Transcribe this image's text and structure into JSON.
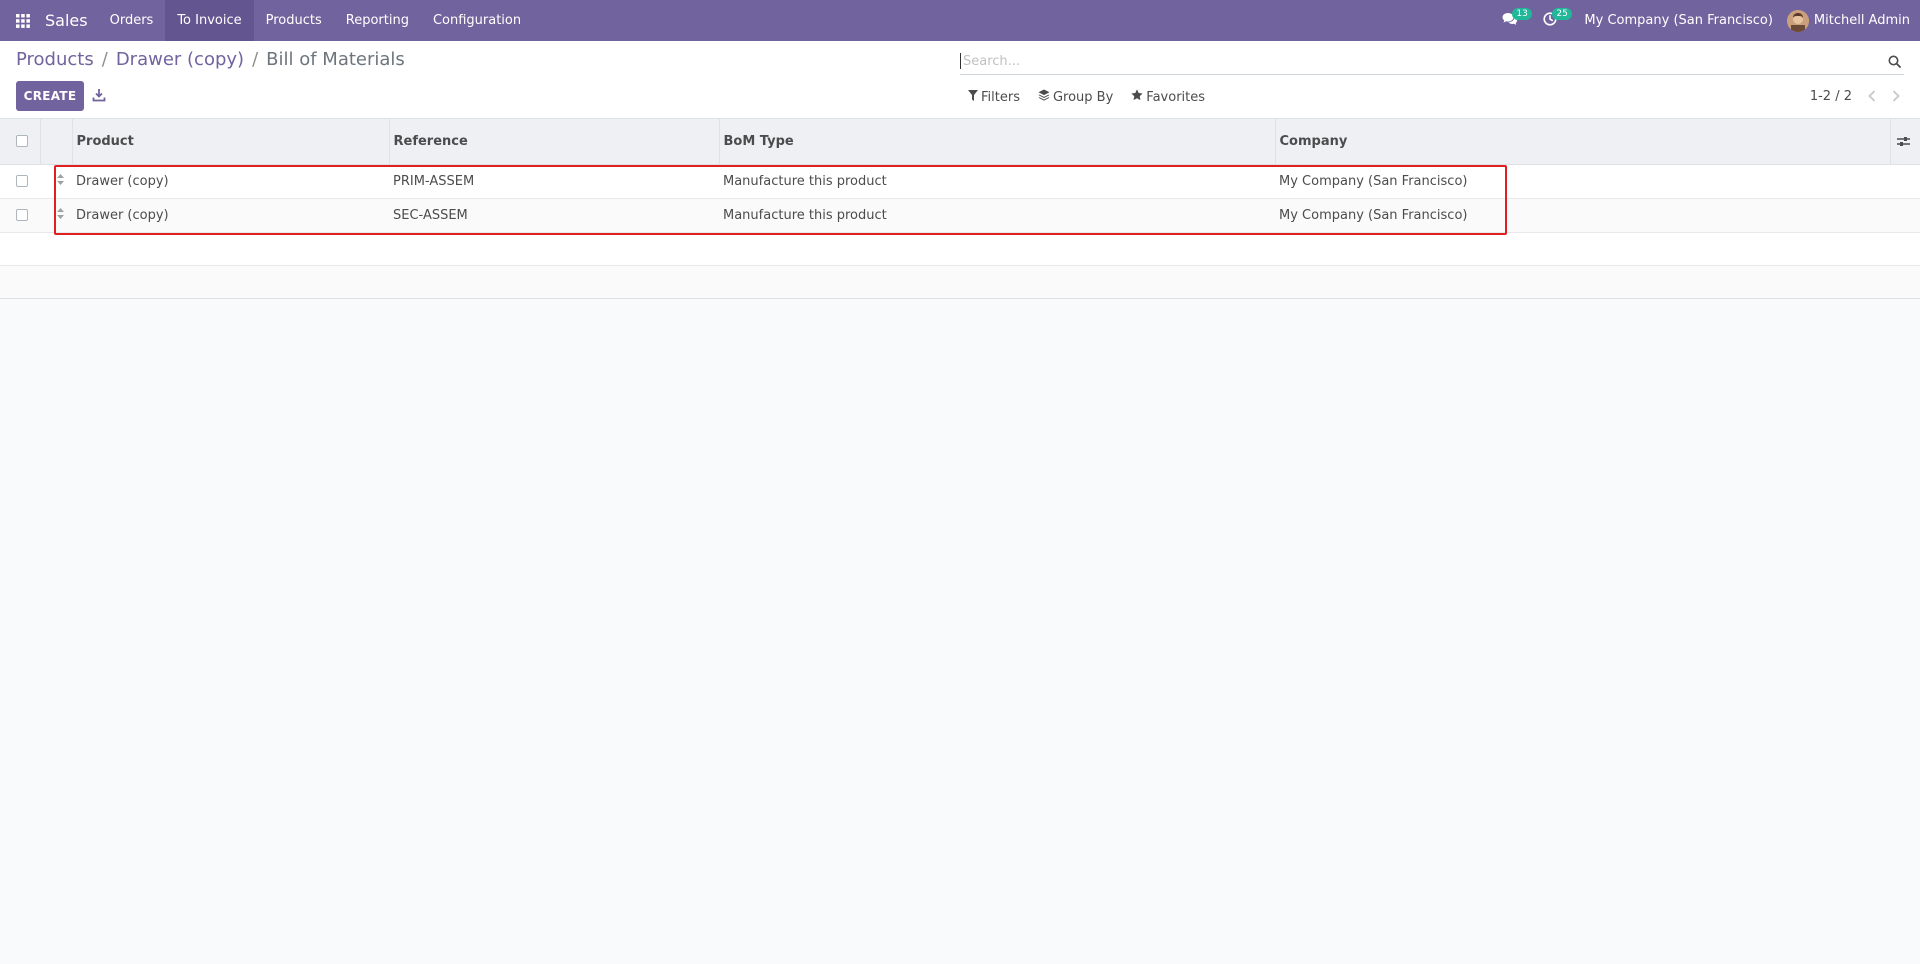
{
  "navbar": {
    "brand": "Sales",
    "menu": [
      {
        "label": "Orders",
        "active": false
      },
      {
        "label": "To Invoice",
        "active": true
      },
      {
        "label": "Products",
        "active": false
      },
      {
        "label": "Reporting",
        "active": false
      },
      {
        "label": "Configuration",
        "active": false
      }
    ],
    "messages_count": "13",
    "activities_count": "25",
    "company": "My Company (San Francisco)",
    "user": "Mitchell Admin"
  },
  "breadcrumb": {
    "items": [
      "Products",
      "Drawer (copy)"
    ],
    "current": "Bill of Materials"
  },
  "toolbar": {
    "create_label": "CREATE"
  },
  "search": {
    "placeholder": "Search...",
    "value": "",
    "filters_label": "Filters",
    "groupby_label": "Group By",
    "favorites_label": "Favorites"
  },
  "pager": {
    "value": "1-2 / 2"
  },
  "table": {
    "columns": [
      "Product",
      "Reference",
      "BoM Type",
      "Company"
    ],
    "rows": [
      {
        "product": "Drawer (copy)",
        "reference": "PRIM-ASSEM",
        "bom_type": "Manufacture this product",
        "company": "My Company (San Francisco)"
      },
      {
        "product": "Drawer (copy)",
        "reference": "SEC-ASSEM",
        "bom_type": "Manufacture this product",
        "company": "My Company (San Francisco)"
      }
    ]
  },
  "colors": {
    "brand": "#71639e",
    "badge": "#21b799",
    "highlight": "#e02020"
  }
}
